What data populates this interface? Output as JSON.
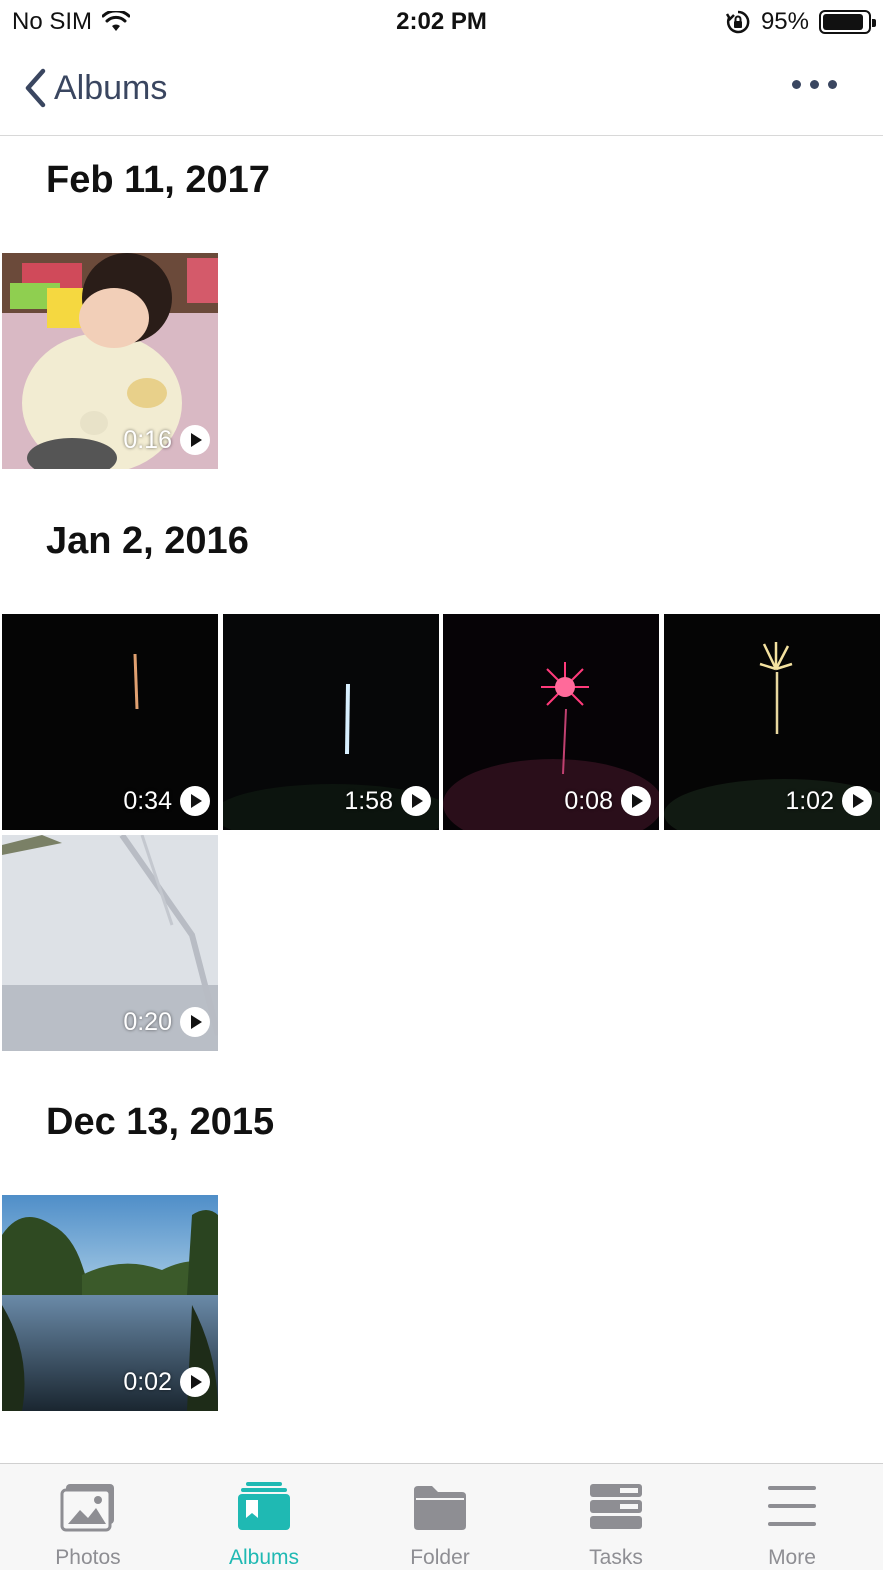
{
  "status_bar": {
    "carrier": "No SIM",
    "time": "2:02 PM",
    "battery": "95%"
  },
  "nav": {
    "back_label": "Albums",
    "more_icon": "ellipsis-icon"
  },
  "sections": [
    {
      "date": "Feb 11, 2017",
      "items": [
        {
          "duration": "0:16",
          "thumb": "baby-photo"
        }
      ]
    },
    {
      "date": "Jan 2, 2016",
      "items": [
        {
          "duration": "0:34",
          "thumb": "firework-rising"
        },
        {
          "duration": "1:58",
          "thumb": "firework-streak"
        },
        {
          "duration": "0:08",
          "thumb": "firework-burst-red"
        },
        {
          "duration": "1:02",
          "thumb": "firework-burst-gold"
        },
        {
          "duration": "0:20",
          "thumb": "snow-field"
        }
      ]
    },
    {
      "date": "Dec 13, 2015",
      "items": [
        {
          "duration": "0:02",
          "thumb": "lake-trees"
        }
      ]
    }
  ],
  "tab_bar": {
    "tabs": [
      {
        "label": "Photos",
        "icon": "photos-icon"
      },
      {
        "label": "Albums",
        "icon": "albums-icon",
        "active": true
      },
      {
        "label": "Folder",
        "icon": "folder-icon"
      },
      {
        "label": "Tasks",
        "icon": "tasks-icon"
      },
      {
        "label": "More",
        "icon": "menu-icon"
      }
    ],
    "active_color": "#1fb9b3",
    "inactive_color": "#8e8e93"
  }
}
